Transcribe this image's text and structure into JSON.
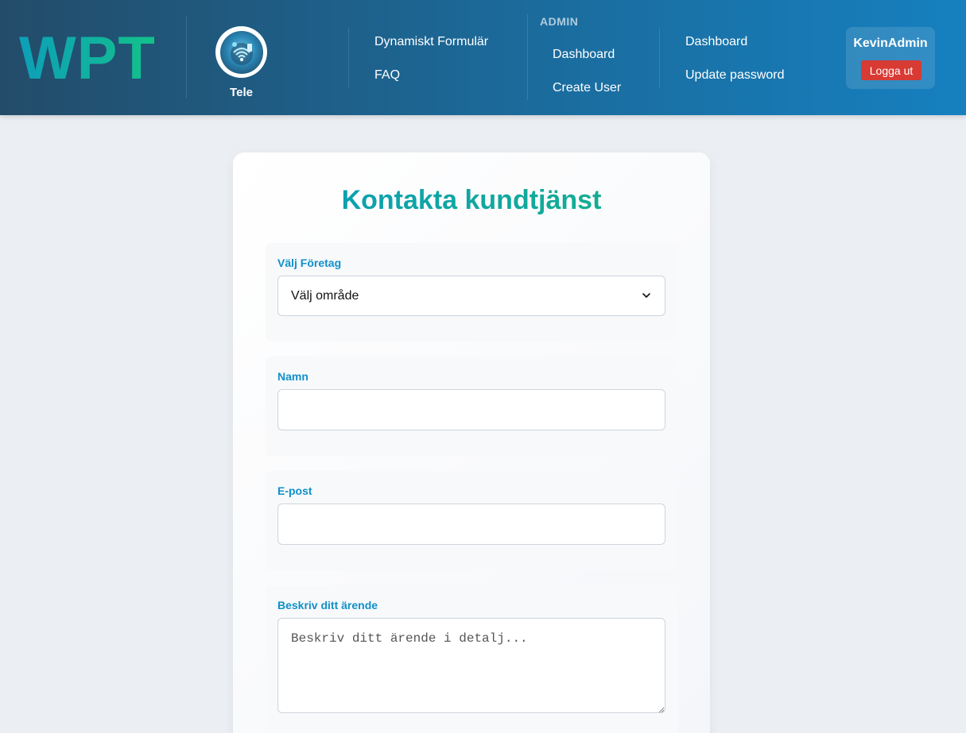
{
  "brand": {
    "logo_text": "WPT",
    "tele_label": "Tele"
  },
  "nav": {
    "main": [
      {
        "label": "Dynamiskt Formulär"
      },
      {
        "label": "FAQ"
      }
    ],
    "admin_heading": "ADMIN",
    "admin": [
      {
        "label": "Dashboard"
      },
      {
        "label": "Create User"
      }
    ],
    "account": [
      {
        "label": "Dashboard"
      },
      {
        "label": "Update password"
      }
    ]
  },
  "user": {
    "name": "KevinAdmin",
    "logout_label": "Logga ut"
  },
  "form": {
    "title": "Kontakta kundtjänst",
    "company": {
      "label": "Välj Företag",
      "selected": "Välj område"
    },
    "name": {
      "label": "Namn",
      "value": ""
    },
    "email": {
      "label": "E-post",
      "value": ""
    },
    "issue": {
      "label": "Beskriv ditt ärende",
      "placeholder": "Beskriv ditt ärende i detalj..."
    }
  },
  "colors": {
    "header_start": "#234c69",
    "header_end": "#1680bf",
    "title_gradient_start": "#0a9bbb",
    "title_gradient_end": "#16b288",
    "label_color": "#1190c8",
    "logout_bg": "#d83a34"
  },
  "icons": {
    "select_chevron": "chevron-down-icon",
    "tele_logo": "telecom-logo-icon",
    "textarea_grip": "resize-grip-icon"
  }
}
